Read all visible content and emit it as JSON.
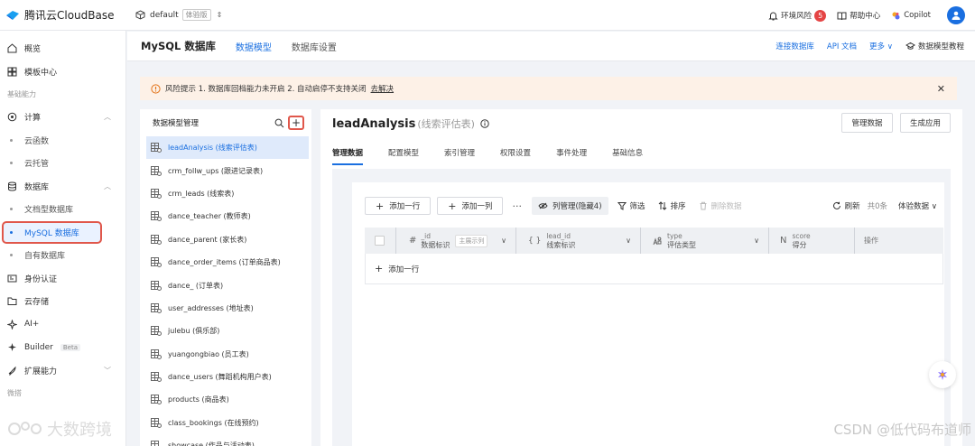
{
  "topbar": {
    "brand": "腾讯云CloudBase",
    "env_name": "default",
    "env_tag": "体验版",
    "risk_label": "环境风险",
    "risk_count": "5",
    "help_label": "帮助中心",
    "copilot_label": "Copilot"
  },
  "sidebar": {
    "overview": "概览",
    "templates": "模板中心",
    "group_basic": "基础能力",
    "compute": "计算",
    "cloud_function": "云函数",
    "cloud_hosting": "云托管",
    "database": "数据库",
    "doc_db": "文档型数据库",
    "mysql_db": "MySQL 数据库",
    "own_db": "自有数据库",
    "auth": "身份认证",
    "storage": "云存储",
    "ai": "AI+",
    "builder": "Builder",
    "builder_badge": "Beta",
    "extensions": "扩展能力",
    "group_mini": "微搭"
  },
  "header": {
    "title": "MySQL 数据库",
    "tabs": [
      {
        "label": "数据模型"
      },
      {
        "label": "数据库设置"
      }
    ],
    "connect_db": "连接数据库",
    "api_doc": "API 文档",
    "more": "更多",
    "tutorial": "数据模型教程"
  },
  "alert": {
    "text": "风险提示  1. 数据库回档能力未开启  2. 自动启停不支持关闭",
    "action": "去解决"
  },
  "model_panel": {
    "title": "数据模型管理",
    "models": [
      "leadAnalysis (线索评估表)",
      "crm_follw_ups (跟进记录表)",
      "crm_leads (线索表)",
      "dance_teacher (教师表)",
      "dance_parent (家长表)",
      "dance_order_items (订单商品表)",
      "dance_ (订单表)",
      "user_addresses (地址表)",
      "julebu (俱乐部)",
      "yuangongbiao (员工表)",
      "dance_users (舞蹈机构用户表)",
      "products (商品表)",
      "class_bookings (在线预约)",
      "showcase (作品与活动表)"
    ]
  },
  "detail": {
    "name": "leadAnalysis",
    "alias": "(线索评估表)",
    "manage_data": "管理数据",
    "generate_app": "生成应用",
    "tabs": [
      "管理数据",
      "配置模型",
      "索引管理",
      "权限设置",
      "事件处理",
      "基础信息"
    ],
    "toolbar": {
      "add_row": "添加一行",
      "add_col": "添加一列",
      "col_manage": "列管理(隐藏4)",
      "filter": "筛选",
      "sort": "排序",
      "delete": "删除数据",
      "refresh": "刷新",
      "count": "共0条",
      "env_data": "体验数据"
    },
    "columns": [
      {
        "en": "_id",
        "cn": "数据标识",
        "example": "主展示列"
      },
      {
        "en": "lead_id",
        "cn": "线索标识"
      },
      {
        "en": "type",
        "cn": "评估类型"
      },
      {
        "en": "score",
        "cn": "得分"
      },
      {
        "en": "",
        "cn": "操作"
      }
    ],
    "add_row_inline": "添加一行"
  },
  "watermark": {
    "left": "大数跨境",
    "right": "CSDN @低代码布道师"
  }
}
